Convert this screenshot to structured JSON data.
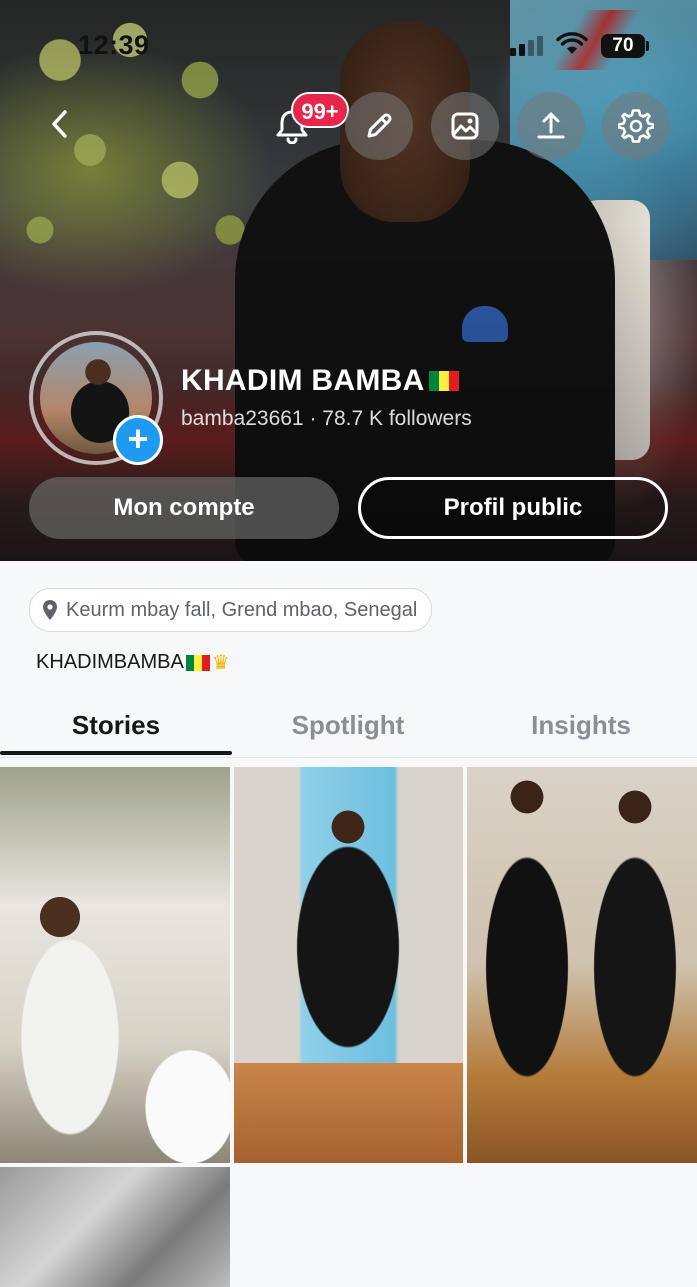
{
  "status_bar": {
    "time": "12:39",
    "battery": "70"
  },
  "header": {
    "notifications_badge": "99+",
    "icons": [
      "back-chevron-icon",
      "bell-icon",
      "pencil-icon",
      "image-icon",
      "upload-icon",
      "gear-icon"
    ]
  },
  "profile": {
    "display_name": "KHADIM BAMBA",
    "username": "bamba23661",
    "separator": "·",
    "followers": "78.7 K followers",
    "buttons": {
      "account": "Mon compte",
      "public": "Profil public"
    }
  },
  "details": {
    "location": "Keurm mbay fall, Grend mbao, Senegal",
    "bio": "KHADIMBAMBA"
  },
  "tabs": [
    {
      "label": "Stories",
      "active": true
    },
    {
      "label": "Spotlight",
      "active": false
    },
    {
      "label": "Insights",
      "active": false
    }
  ],
  "colors": {
    "accent_blue": "#1e9bf0",
    "badge_red": "#e8264b",
    "senegal_green": "#00853f",
    "senegal_yellow": "#fdef42",
    "senegal_red": "#e31b23"
  }
}
